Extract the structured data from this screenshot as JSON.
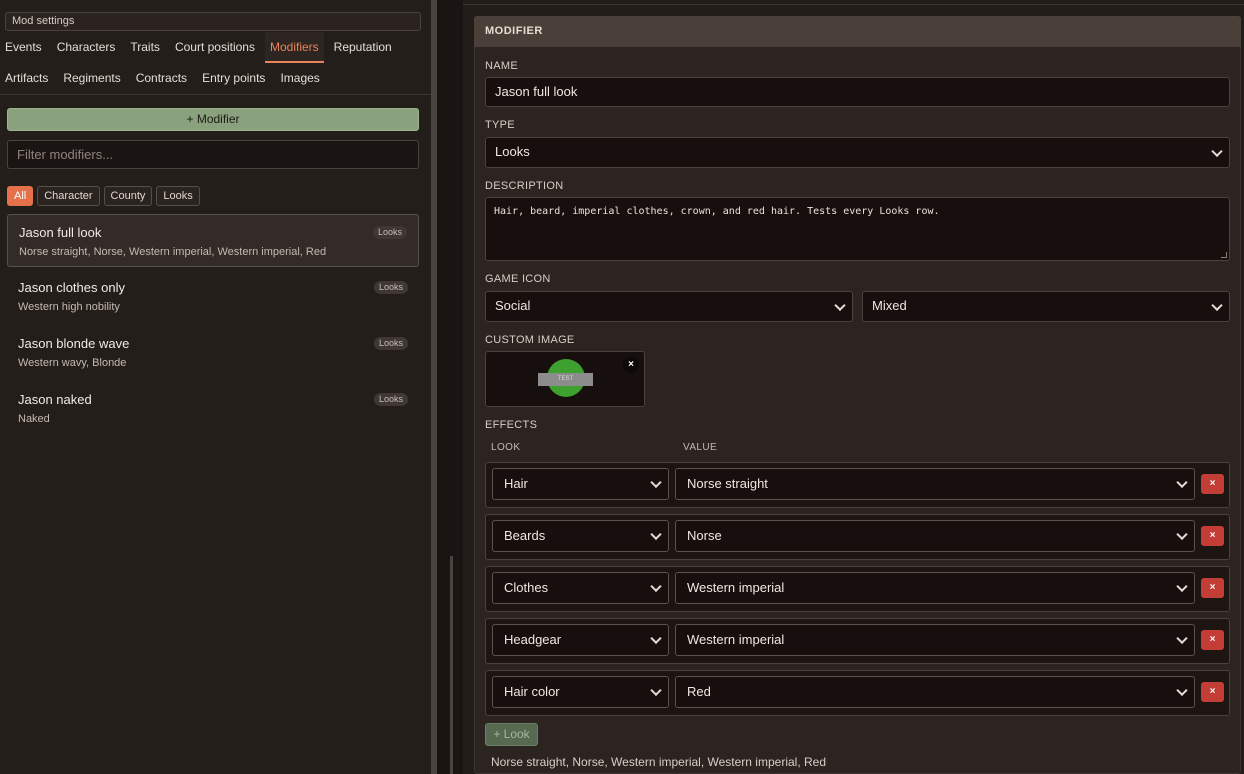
{
  "left": {
    "mod_settings": "Mod settings",
    "nav_row1": [
      "Events",
      "Characters",
      "Traits",
      "Court positions",
      "Modifiers",
      "Reputation"
    ],
    "nav_row2": [
      "Artifacts",
      "Regiments",
      "Contracts",
      "Entry points",
      "Images"
    ],
    "active_tab": "Modifiers",
    "add_button": "+ Modifier",
    "filter_placeholder": "Filter modifiers...",
    "chips": [
      "All",
      "Character",
      "County",
      "Looks"
    ],
    "active_chip": "All",
    "items": [
      {
        "name": "Jason full look",
        "sub": "Norse straight, Norse, Western imperial, Western imperial, Red",
        "badge": "Looks",
        "selected": true
      },
      {
        "name": "Jason clothes only",
        "sub": "Western high nobility",
        "badge": "Looks",
        "selected": false
      },
      {
        "name": "Jason blonde wave",
        "sub": "Western wavy, Blonde",
        "badge": "Looks",
        "selected": false
      },
      {
        "name": "Jason naked",
        "sub": "Naked",
        "badge": "Looks",
        "selected": false
      }
    ]
  },
  "right": {
    "header": "MODIFIER",
    "name_label": "NAME",
    "name_value": "Jason full look",
    "type_label": "TYPE",
    "type_value": "Looks",
    "desc_label": "DESCRIPTION",
    "desc_value": "Hair, beard, imperial clothes, crown, and red hair. Tests every Looks row.",
    "icon_label": "GAME ICON",
    "icon_value1": "Social",
    "icon_value2": "Mixed",
    "image_label": "CUSTOM IMAGE",
    "image_text": "TEST",
    "image_remove": "×",
    "effects_label": "EFFECTS",
    "col_look": "LOOK",
    "col_value": "VALUE",
    "effects": [
      {
        "look": "Hair",
        "value": "Norse straight"
      },
      {
        "look": "Beards",
        "value": "Norse"
      },
      {
        "look": "Clothes",
        "value": "Western imperial"
      },
      {
        "look": "Headgear",
        "value": "Western imperial"
      },
      {
        "look": "Hair color",
        "value": "Red"
      }
    ],
    "delete_glyph": "×",
    "add_look": "+ Look",
    "summary": "Norse straight, Norse, Western imperial, Western imperial, Red"
  },
  "colors": {
    "accent": "#e8845c",
    "add_button": "#8aa17e",
    "delete": "#c33d36",
    "image_circle": "#3ea02e"
  }
}
